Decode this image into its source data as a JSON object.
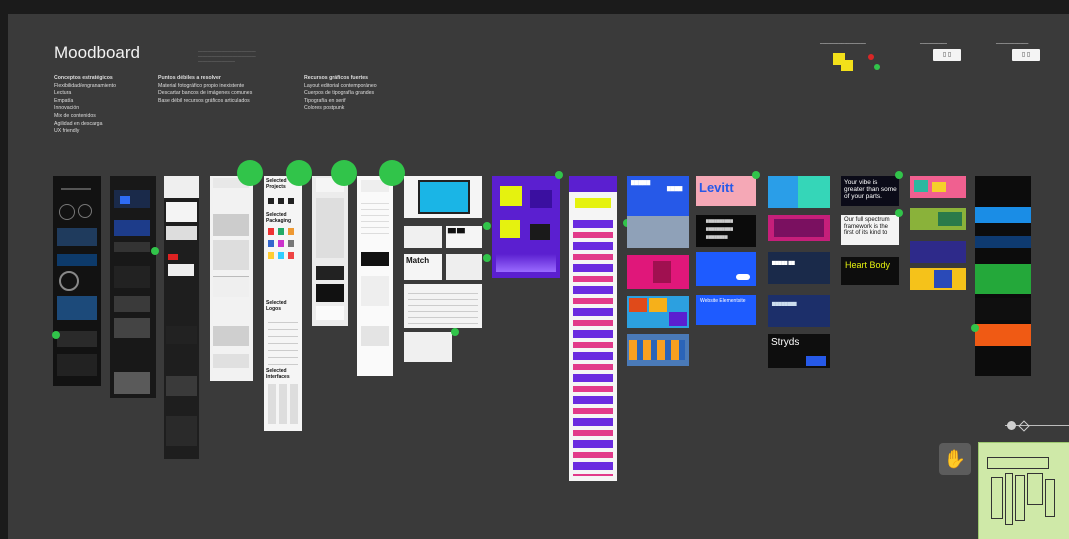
{
  "board": {
    "title": "Moodboard",
    "columns": [
      {
        "heading": "Conceptos estratégicos",
        "items": [
          "Flexibilidad/engranamiento",
          "Lectura",
          "Empatía",
          "Innovación",
          "Mix de contenidos",
          "Agilidad en descarga",
          "UX friendly"
        ]
      },
      {
        "heading": "Puntos débiles a resolver",
        "items": [
          "Material fotográfico propio inexistente",
          "Descartar bancos de imágenes comunes",
          "Base débil recursos gráficos articulados"
        ]
      },
      {
        "heading": "Recursos gráficos fuertes",
        "items": [
          "Layout editorial contemporáneo",
          "Cuerpos de tipografía grandes",
          "Tipografía en serif",
          "Colores postpunk"
        ]
      }
    ]
  },
  "tile_texts": {
    "selected_projects": "Selected Projects",
    "selected_packaging": "Selected Packaging",
    "selected_logos": "Selected Logos",
    "selected_interfaces": "Selected Interfaces",
    "match": "Match",
    "levitt": "Levitt",
    "stryds": "Stryds",
    "heart_body": "Heart Body",
    "your_vibe": "Your vibe is greater than some of your parts.",
    "our_full_spectrum": "Our full spectrum framework is the first of its kind to",
    "website": "Website Elementsite"
  },
  "colors": {
    "canvas": "#3a3a3a",
    "accent_green": "#31c44a",
    "sticky_yellow": "#f3e01a",
    "purple": "#5b1fd0",
    "blue": "#2659e8"
  },
  "controls": {
    "hand_tool_icon": "hand-icon",
    "zoom_slider_icon": "zoom-slider-icon",
    "minimap_icon": "minimap-icon"
  }
}
